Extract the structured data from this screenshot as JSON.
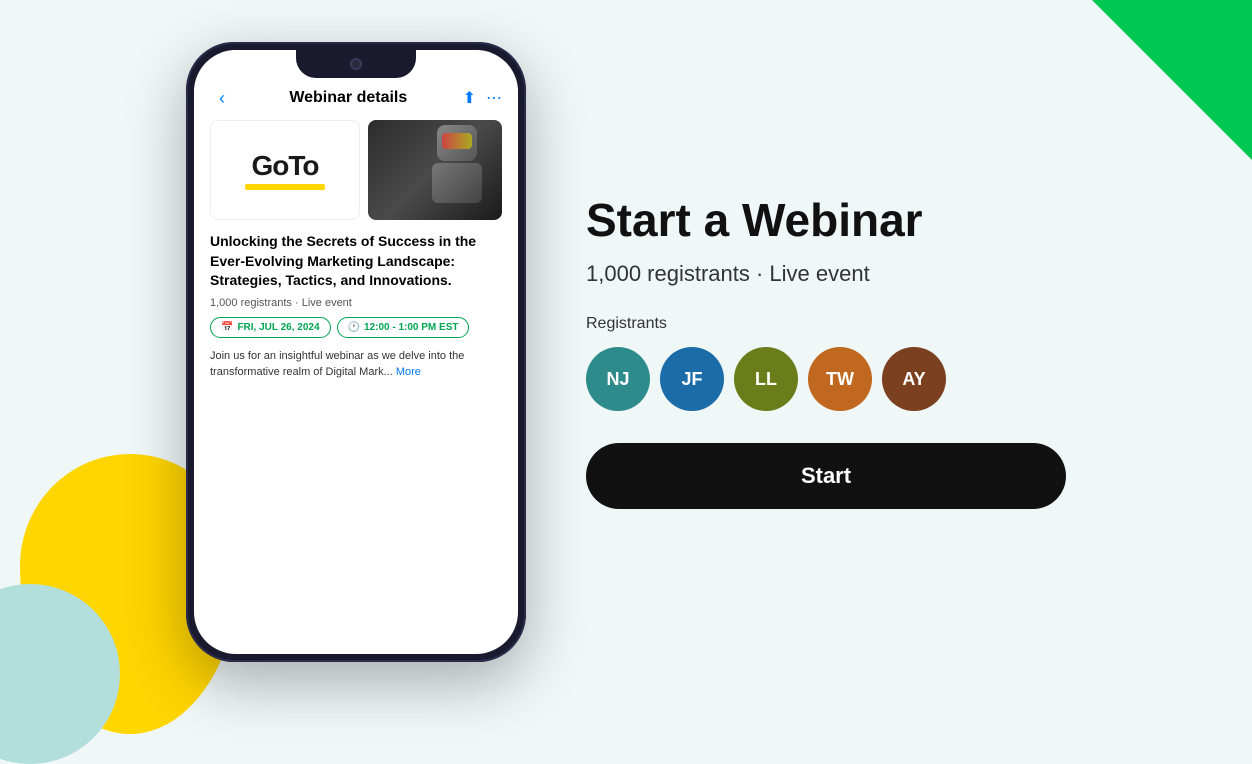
{
  "background": {
    "color": "#f0f7f7"
  },
  "phone": {
    "header": {
      "back_icon": "‹",
      "title": "Webinar details",
      "upload_icon": "⬆",
      "more_icon": "⋯"
    },
    "webinar": {
      "logo_text": "GoTo",
      "title": "Unlocking the Secrets of Success in the Ever-Evolving Marketing Landscape: Strategies, Tactics, and Innovations.",
      "meta": "1,000 registrants · Live event",
      "badge_date": "FRI, JUL 26, 2024",
      "badge_time": "12:00 - 1:00 PM EST",
      "description": "Join us for an insightful webinar as we delve into the transformative realm of Digital Mark...",
      "more_link": "More"
    }
  },
  "right_panel": {
    "title": "Start a Webinar",
    "event_info": "1,000 registrants · Live event",
    "registrants_label": "Registrants",
    "avatars": [
      {
        "initials": "NJ",
        "color_class": "avatar-nj"
      },
      {
        "initials": "JF",
        "color_class": "avatar-jf"
      },
      {
        "initials": "LL",
        "color_class": "avatar-ll"
      },
      {
        "initials": "TW",
        "color_class": "avatar-tw"
      },
      {
        "initials": "AY",
        "color_class": "avatar-ay"
      }
    ],
    "start_button": "Start"
  }
}
